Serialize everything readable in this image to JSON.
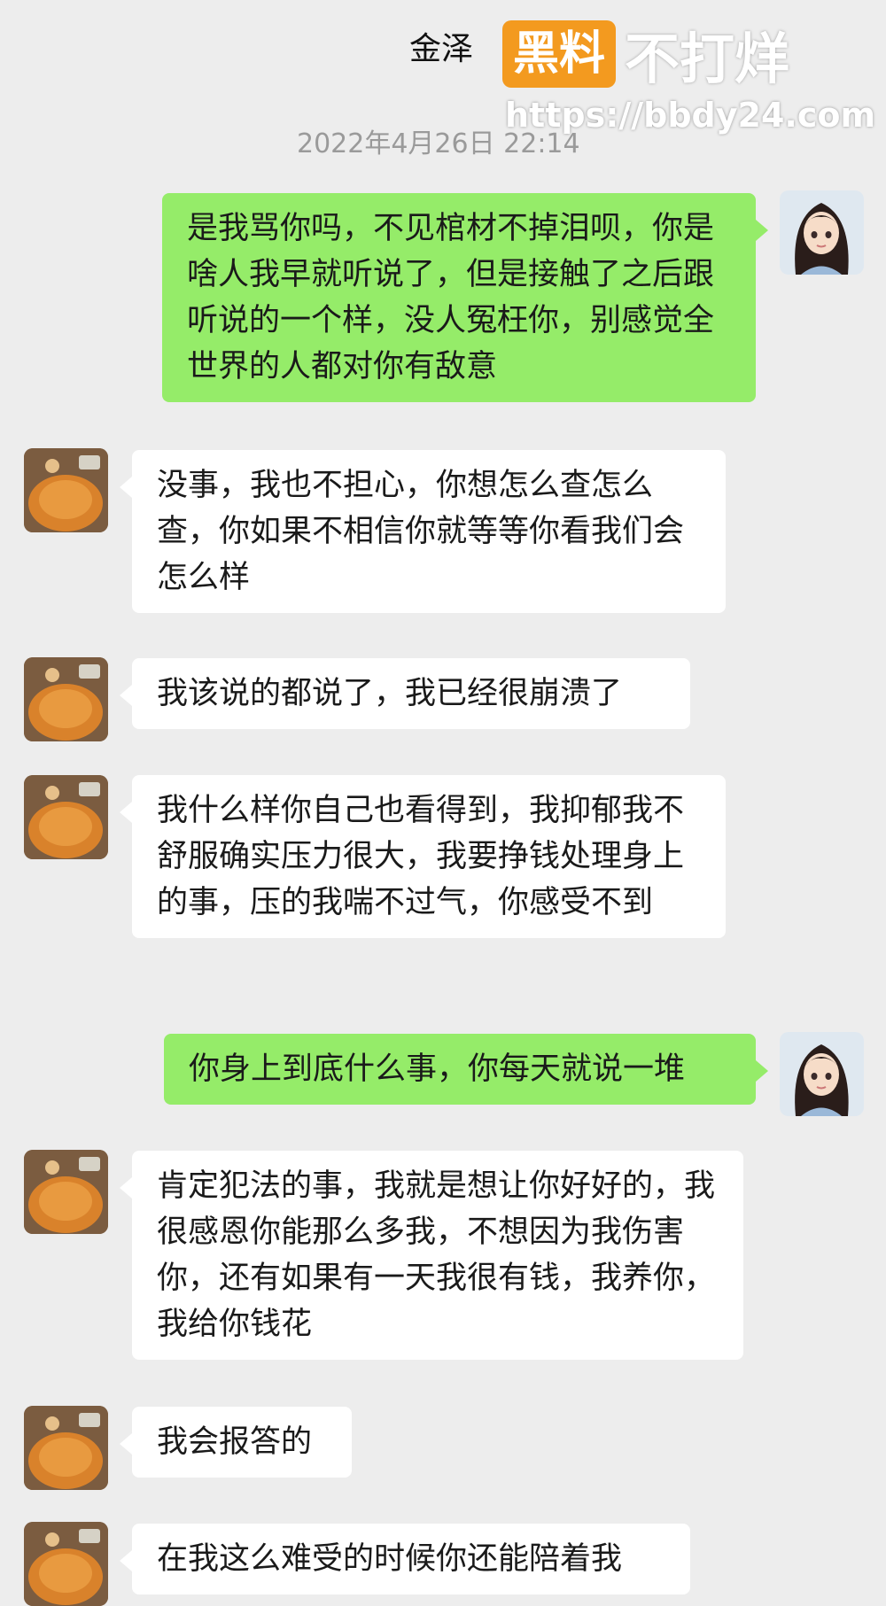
{
  "header": {
    "title": "金泽"
  },
  "watermark": {
    "box_text": "黑料",
    "text": "不打烊",
    "url": "https://bbdy24.com"
  },
  "timestamp": "2022年4月26日 22:14",
  "messages": [
    {
      "side": "out",
      "text": "是我骂你吗，不见棺材不掉泪呗，你是啥人我早就听说了，但是接触了之后跟听说的一个样，没人冤枉你，别感觉全世界的人都对你有敌意"
    },
    {
      "side": "in",
      "text": "没事，我也不担心，你想怎么查怎么查，你如果不相信你就等等你看我们会怎么样"
    },
    {
      "side": "in",
      "text": "我该说的都说了，我已经很崩溃了"
    },
    {
      "side": "in",
      "text": "我什么样你自己也看得到，我抑郁我不舒服确实压力很大，我要挣钱处理身上的事，压的我喘不过气，你感受不到"
    },
    {
      "side": "out",
      "text": "你身上到底什么事，你每天就说一堆"
    },
    {
      "side": "in",
      "text": "肯定犯法的事，我就是想让你好好的，我很感恩你能那么多我，不想因为我伤害你，还有如果有一天我很有钱，我养你，我给你钱花"
    },
    {
      "side": "in",
      "text": "我会报答的"
    },
    {
      "side": "in",
      "text": "在我这么难受的时候你还能陪着我"
    }
  ],
  "colors": {
    "background": "#ededed",
    "outgoing_bubble": "#95ec69",
    "incoming_bubble": "#ffffff",
    "watermark_orange": "#f39a1f"
  }
}
